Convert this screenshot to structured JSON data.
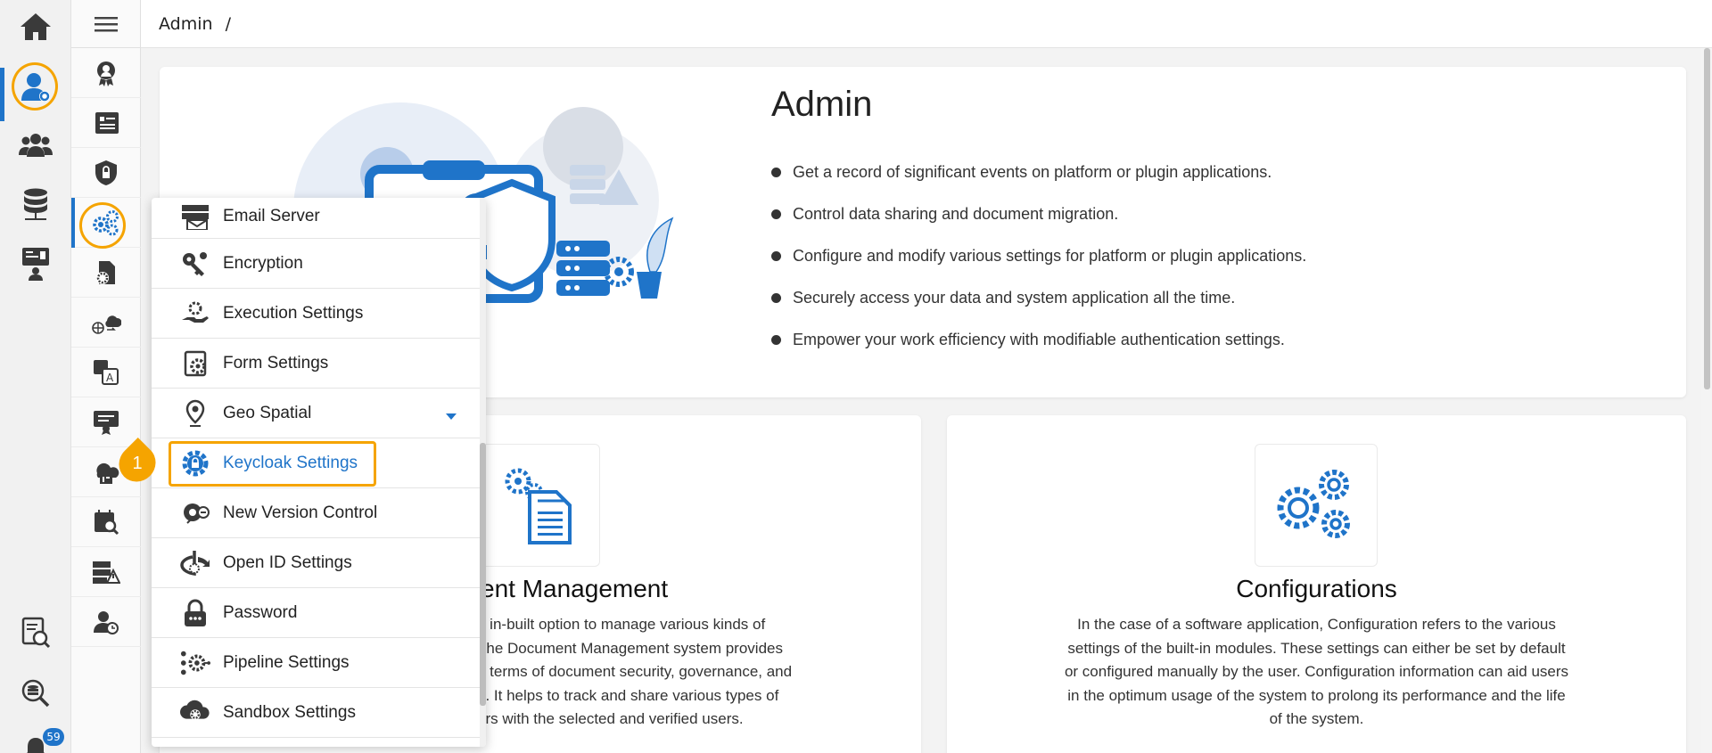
{
  "breadcrumb": {
    "root": "Admin",
    "separator": "/"
  },
  "rail": {
    "items": [
      "home-icon",
      "admin-user-icon",
      "users-group-icon",
      "database-icon",
      "presentation-icon",
      "report-search-icon",
      "data-search-icon",
      "notifications-icon"
    ],
    "notification_count": "59"
  },
  "sub_sidebar": {
    "items": [
      "audit-icon",
      "document-management-icon",
      "security-icon",
      "configurations-icon",
      "document-settings-icon",
      "network-cloud-icon",
      "language-icon",
      "certificate-icon",
      "api-cloud-icon",
      "schedule-search-icon",
      "server-alert-icon",
      "user-history-icon"
    ]
  },
  "hero": {
    "title": "Admin",
    "bullets": [
      "Get a record of significant events on platform or plugin applications.",
      "Control data sharing and document migration.",
      "Configure and modify various settings for platform or plugin applications.",
      "Securely access your data and system application all the time.",
      "Empower your work efficiency with modifiable authentication settings."
    ]
  },
  "cards": {
    "doc": {
      "title": "ent Management",
      "lines": [
        "n in-built option to manage various kinds of",
        "The Document Management system provides",
        "n terms of document security, governance, and",
        "e. It helps to track and share various types of",
        "ers with the selected and verified users."
      ]
    },
    "config": {
      "title": "Configurations",
      "lines": [
        "In the case of a software application, Configuration refers to the various",
        "settings of the built-in modules. These settings can either be set by default",
        "or configured manually by the user. Configuration information can aid users",
        "in the optimum usage of the system to prolong its performance and the life",
        "of the system."
      ]
    }
  },
  "menu": {
    "items": [
      {
        "label": "Email Server",
        "icon": "email-server-icon"
      },
      {
        "label": "Encryption",
        "icon": "key-icon"
      },
      {
        "label": "Execution Settings",
        "icon": "execution-settings-icon"
      },
      {
        "label": "Form Settings",
        "icon": "form-settings-icon"
      },
      {
        "label": "Geo Spatial",
        "icon": "map-pin-icon"
      },
      {
        "label": "Keycloak Settings",
        "icon": "keycloak-icon"
      },
      {
        "label": "New Version Control",
        "icon": "version-control-icon"
      },
      {
        "label": "Open ID Settings",
        "icon": "openid-icon"
      },
      {
        "label": "Password",
        "icon": "lock-icon"
      },
      {
        "label": "Pipeline Settings",
        "icon": "pipeline-icon"
      },
      {
        "label": "Sandbox Settings",
        "icon": "sandbox-icon"
      }
    ],
    "selected": "Keycloak Settings",
    "step_marker": "1"
  },
  "colors": {
    "accent": "#1f74c9",
    "highlight": "#f5a400",
    "icon": "#3a3a3a"
  }
}
